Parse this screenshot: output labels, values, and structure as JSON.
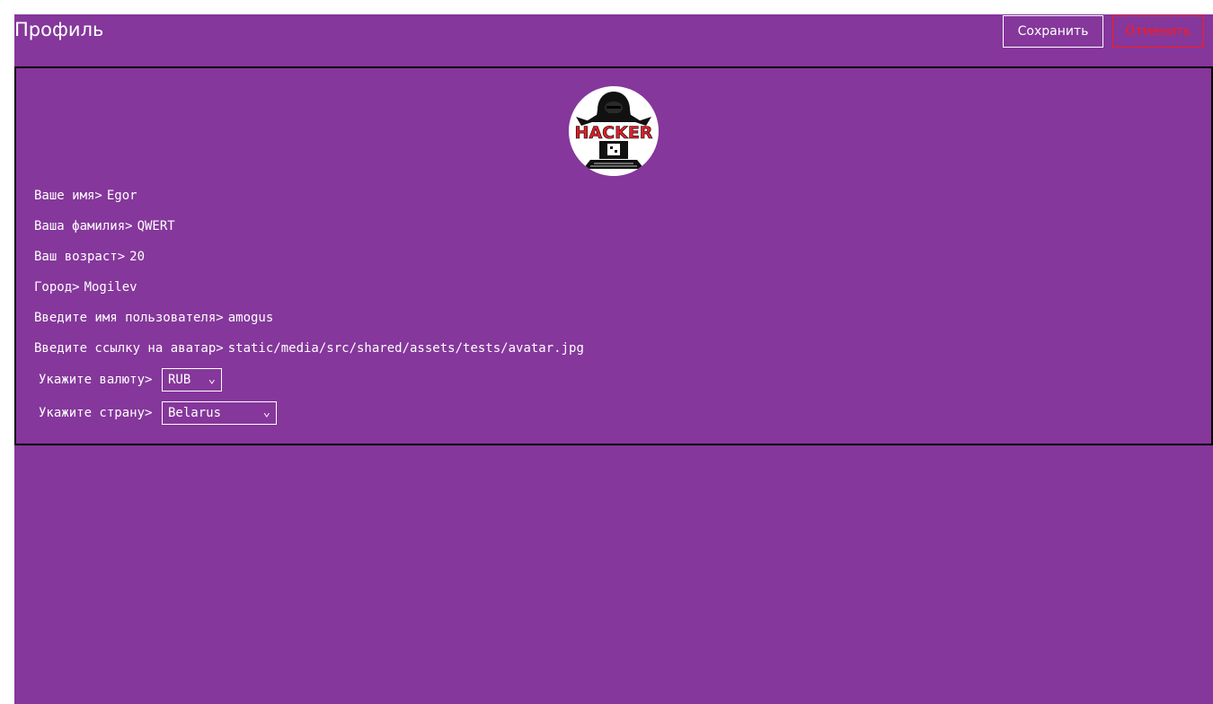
{
  "header": {
    "title": "Профиль",
    "save_label": "Сохранить",
    "cancel_label": "Отменить"
  },
  "avatar": {
    "text": "HACKER"
  },
  "form": {
    "first_name": {
      "label": "Ваше имя>",
      "value": "Egor"
    },
    "last_name": {
      "label": "Ваша фамилия>",
      "value": "QWERT"
    },
    "age": {
      "label": "Ваш возраст>",
      "value": "20"
    },
    "city": {
      "label": "Город>",
      "value": "Mogilev"
    },
    "username": {
      "label": "Введите имя пользователя>",
      "value": "amogus"
    },
    "avatar_url": {
      "label": "Введите ссылку на аватар>",
      "value": "static/media/src/shared/assets/tests/avatar.jpg"
    },
    "currency": {
      "label": "Укажите валюту>",
      "selected": "RUB"
    },
    "country": {
      "label": "Укажите страну>",
      "selected": "Belarus"
    }
  },
  "colors": {
    "background": "#85379b",
    "cancel": "#ff1a1a",
    "text": "#ffffff"
  }
}
